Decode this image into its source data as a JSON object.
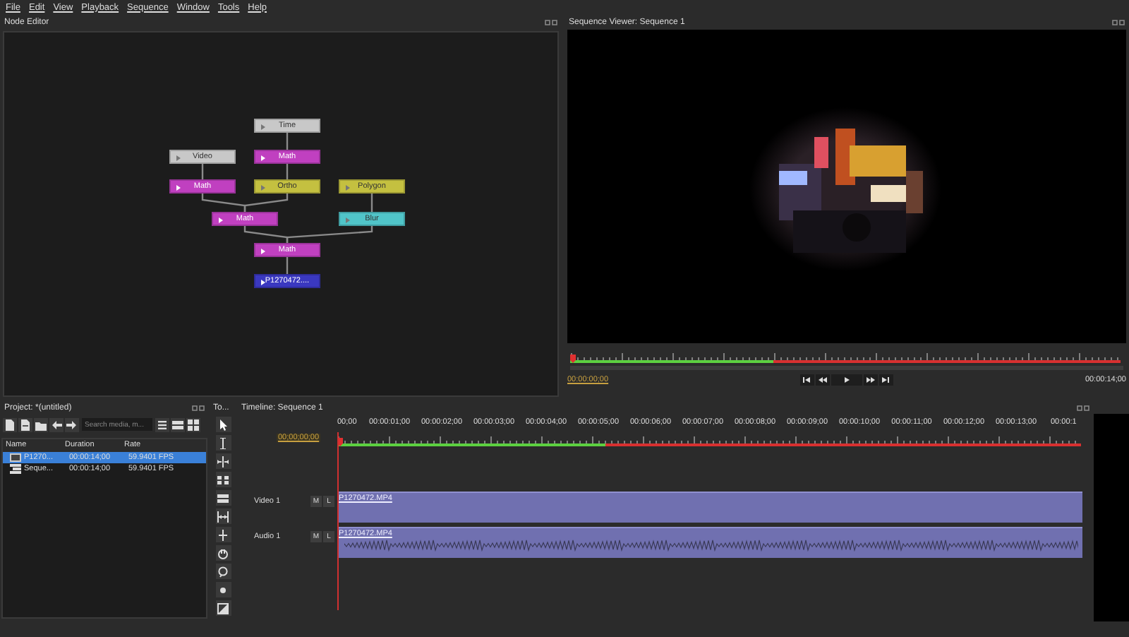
{
  "menu": [
    "File",
    "Edit",
    "View",
    "Playback",
    "Sequence",
    "Window",
    "Tools",
    "Help"
  ],
  "node_editor": {
    "title": "Node Editor",
    "nodes": [
      {
        "label": "Time",
        "color": "#c8c8c8"
      },
      {
        "label": "Math",
        "color": "#c040c0"
      },
      {
        "label": "Video",
        "color": "#c8c8c8"
      },
      {
        "label": "Math",
        "color": "#c040c0"
      },
      {
        "label": "Ortho",
        "color": "#c4c040"
      },
      {
        "label": "Polygon",
        "color": "#c4c040"
      },
      {
        "label": "Math",
        "color": "#c040c0"
      },
      {
        "label": "Blur",
        "color": "#50c4c8"
      },
      {
        "label": "Math",
        "color": "#c040c0"
      },
      {
        "label": "P1270472....",
        "color": "#3a38c0"
      }
    ]
  },
  "viewer": {
    "title": "Sequence Viewer: Sequence 1",
    "current_time": "00:00:00;00",
    "end_time": "00:00:14;00",
    "ruler": {
      "level": 0.37
    }
  },
  "project": {
    "title": "Project: *(untitled)",
    "search": {
      "placeholder": "Search media, m..."
    },
    "columns": [
      "Name",
      "Duration",
      "Rate"
    ],
    "rows": [
      {
        "kind": "footage",
        "name": "P1270...",
        "duration": "00:00:14;00",
        "rate": "59.9401 FPS",
        "selected": true
      },
      {
        "kind": "sequence",
        "name": "Seque...",
        "duration": "00:00:14;00",
        "rate": "59.9401 FPS",
        "selected": false
      }
    ]
  },
  "tools": {
    "title": "To..."
  },
  "timeline": {
    "title": "Timeline: Sequence 1",
    "current_time": "00;00;00;00",
    "ruler": {
      "level": 0.36,
      "labels": [
        "00;00",
        "00:00:01;00",
        "00:00:02;00",
        "00:00:03;00",
        "00:00:04;00",
        "00:00:05;00",
        "00:00:06;00",
        "00:00:07;00",
        "00:00:08;00",
        "00:00:09;00",
        "00:00:10;00",
        "00:00:11;00",
        "00:00:12;00",
        "00:00:13;00",
        "00:00:1"
      ]
    },
    "tracks": [
      {
        "kind": "video",
        "name": "Video 1",
        "mute": "M",
        "lock": "L",
        "clip": "P1270472.MP4"
      },
      {
        "kind": "audio",
        "name": "Audio 1",
        "mute": "M",
        "lock": "L",
        "clip": "P1270472.MP4"
      }
    ]
  }
}
